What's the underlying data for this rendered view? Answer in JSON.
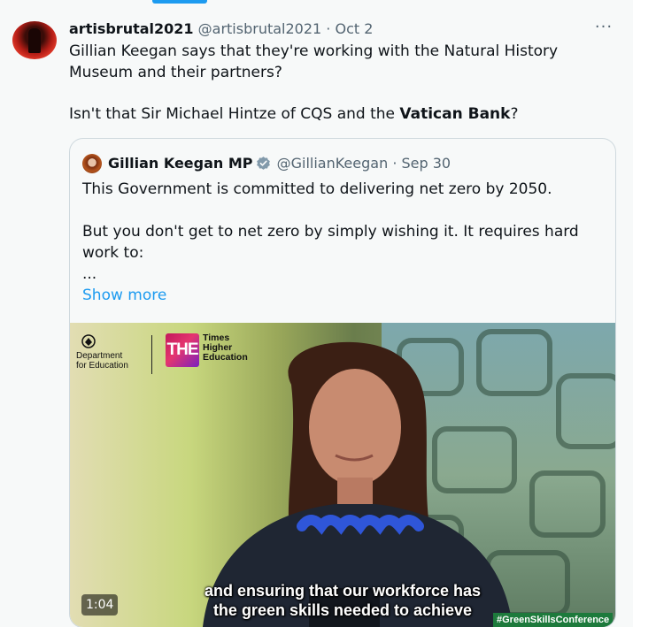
{
  "tweet": {
    "display_name": "artisbrutal2021",
    "handle": "@artisbrutal2021",
    "separator": "·",
    "date": "Oct 2",
    "more_label": "···",
    "text_line1": "Gillian Keegan says that they're working with the Natural History Museum and their partners?",
    "text_line2_prefix": "Isn't that Sir Michael Hintze of CQS and the ",
    "text_line2_bold": "Vatican Bank",
    "text_line2_suffix": "?"
  },
  "quoted": {
    "display_name": "Gillian Keegan MP",
    "handle": "@GillianKeegan",
    "separator": "·",
    "date": "Sep 30",
    "verified_badge": "verified-gray",
    "line1": "This Government is committed to delivering net zero by 2050.",
    "line2": "But you don't get to net zero by simply wishing it. It requires hard work to:",
    "line3": "...",
    "show_more": "Show more"
  },
  "video": {
    "dfe_line1": "Department",
    "dfe_line2": "for Education",
    "the_logo": "THE",
    "the_line1": "Times",
    "the_line2": "Higher",
    "the_line3": "Education",
    "caption_line1": "and ensuring that our workforce has",
    "caption_line2": "the green skills needed to achieve",
    "duration": "1:04",
    "hashtag": "#GreenSkillsConference"
  },
  "colors": {
    "accent": "#1d9bf0",
    "text": "#0f1419",
    "secondary": "#536471",
    "border": "#cfd9de"
  }
}
